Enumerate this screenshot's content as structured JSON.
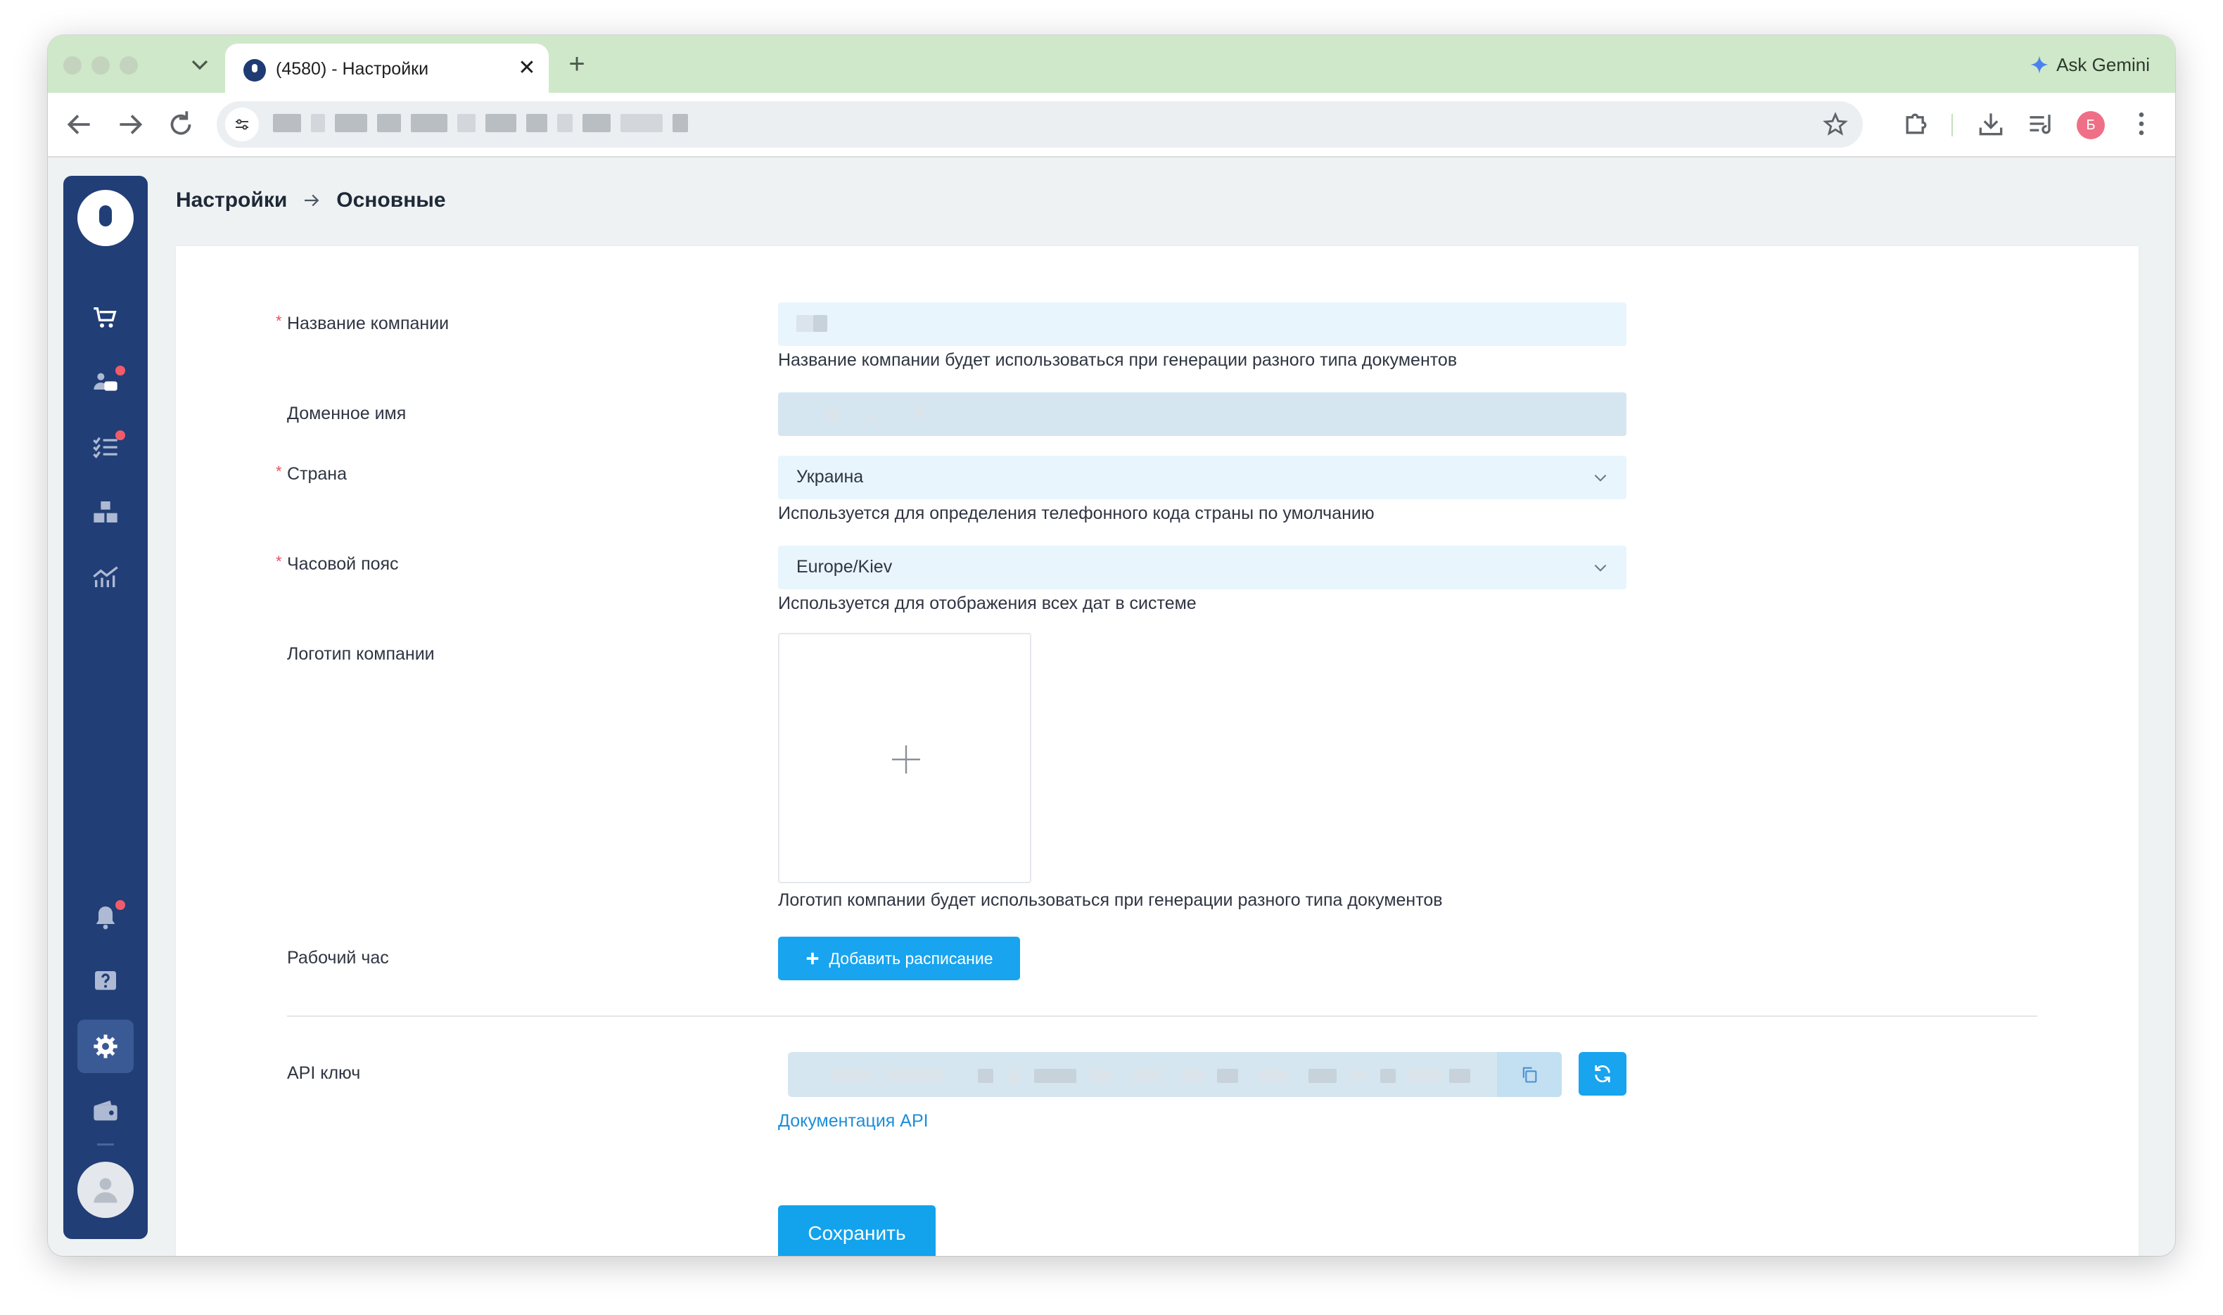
{
  "browser": {
    "tab_title": "(4580) - Настройки",
    "tab_close": "✕",
    "new_tab": "+",
    "gemini_label": "Ask Gemini",
    "profile_initial": "Б"
  },
  "breadcrumb": {
    "parent": "Настройки",
    "current": "Основные"
  },
  "form": {
    "required_mark": "*",
    "company_name": {
      "label": "Название компании",
      "help": "Название компании будет использоваться при генерации разного типа документов"
    },
    "domain_name": {
      "label": "Доменное имя"
    },
    "country": {
      "label": "Страна",
      "value": "Украина",
      "help": "Используется для определения телефонного кода страны по умолчанию"
    },
    "timezone": {
      "label": "Часовой пояс",
      "value": "Europe/Kiev",
      "help": "Используется для отображения всех дат в системе"
    },
    "logo": {
      "label": "Логотип компании",
      "help": "Логотип компании будет использоваться при генерации разного типа документов"
    },
    "working_hours": {
      "label": "Рабочий час",
      "button": "Добавить расписание"
    },
    "api_key": {
      "label": "API ключ",
      "doc_link": "Документация API"
    },
    "save_button": "Сохранить"
  },
  "colors": {
    "sidebar": "#213e76",
    "primary": "#18a4ef",
    "required": "#e4525f",
    "link": "#1d8ed8"
  },
  "icons": [
    "cart-icon",
    "users-chat-icon",
    "tasks-icon",
    "warehouse-icon",
    "analytics-icon",
    "bell-icon",
    "help-icon",
    "gear-icon",
    "wallet-icon",
    "user-icon"
  ]
}
